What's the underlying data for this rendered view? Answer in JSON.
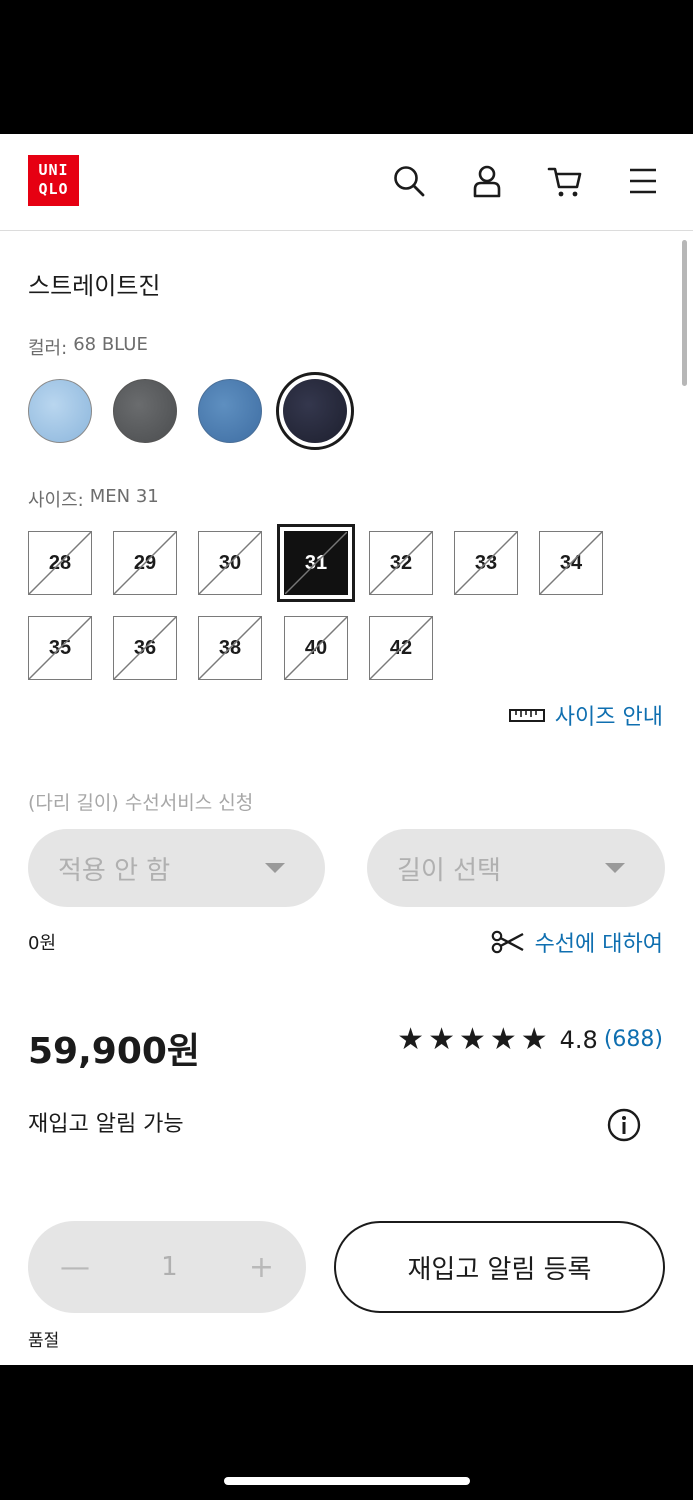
{
  "header": {
    "logo_line1": "UNI",
    "logo_line2": "QLO",
    "icons": [
      "search-icon",
      "account-icon",
      "cart-icon",
      "menu-icon"
    ]
  },
  "product": {
    "title": "스트레이트진",
    "color_label": "컬러:",
    "color_value": "68 BLUE",
    "swatches": [
      {
        "name": "light-blue",
        "color": "#9cc3e4"
      },
      {
        "name": "gray",
        "color": "#5a5c5e"
      },
      {
        "name": "blue",
        "color": "#4e7fb2"
      },
      {
        "name": "navy",
        "color": "#25273a",
        "selected": true
      }
    ],
    "size_label": "사이즈:",
    "size_value": "MEN 31",
    "sizes_row1": [
      "28",
      "29",
      "30",
      "31",
      "32",
      "33",
      "34"
    ],
    "sizes_row2": [
      "35",
      "36",
      "38",
      "40",
      "42"
    ],
    "selected_size": "31",
    "size_guide": "사이즈 안내"
  },
  "alteration": {
    "title": "(다리 길이) 수선서비스 신청",
    "dropdown1": "적용 안 함",
    "dropdown2": "길이 선택",
    "fee": "0원",
    "info_link": "수선에 대하여"
  },
  "pricing": {
    "price": "59,900원",
    "rating_value": "4.8",
    "review_count": "(688)",
    "stars": 5
  },
  "stock": {
    "restock_text": "재입고 알림 가능",
    "quantity": "1",
    "restock_button": "재입고 알림 등록",
    "soldout": "품절"
  },
  "colors": {
    "accent_link": "#0f6fb0",
    "brand_red": "#e60012",
    "disabled_bg": "#e5e5e5"
  }
}
